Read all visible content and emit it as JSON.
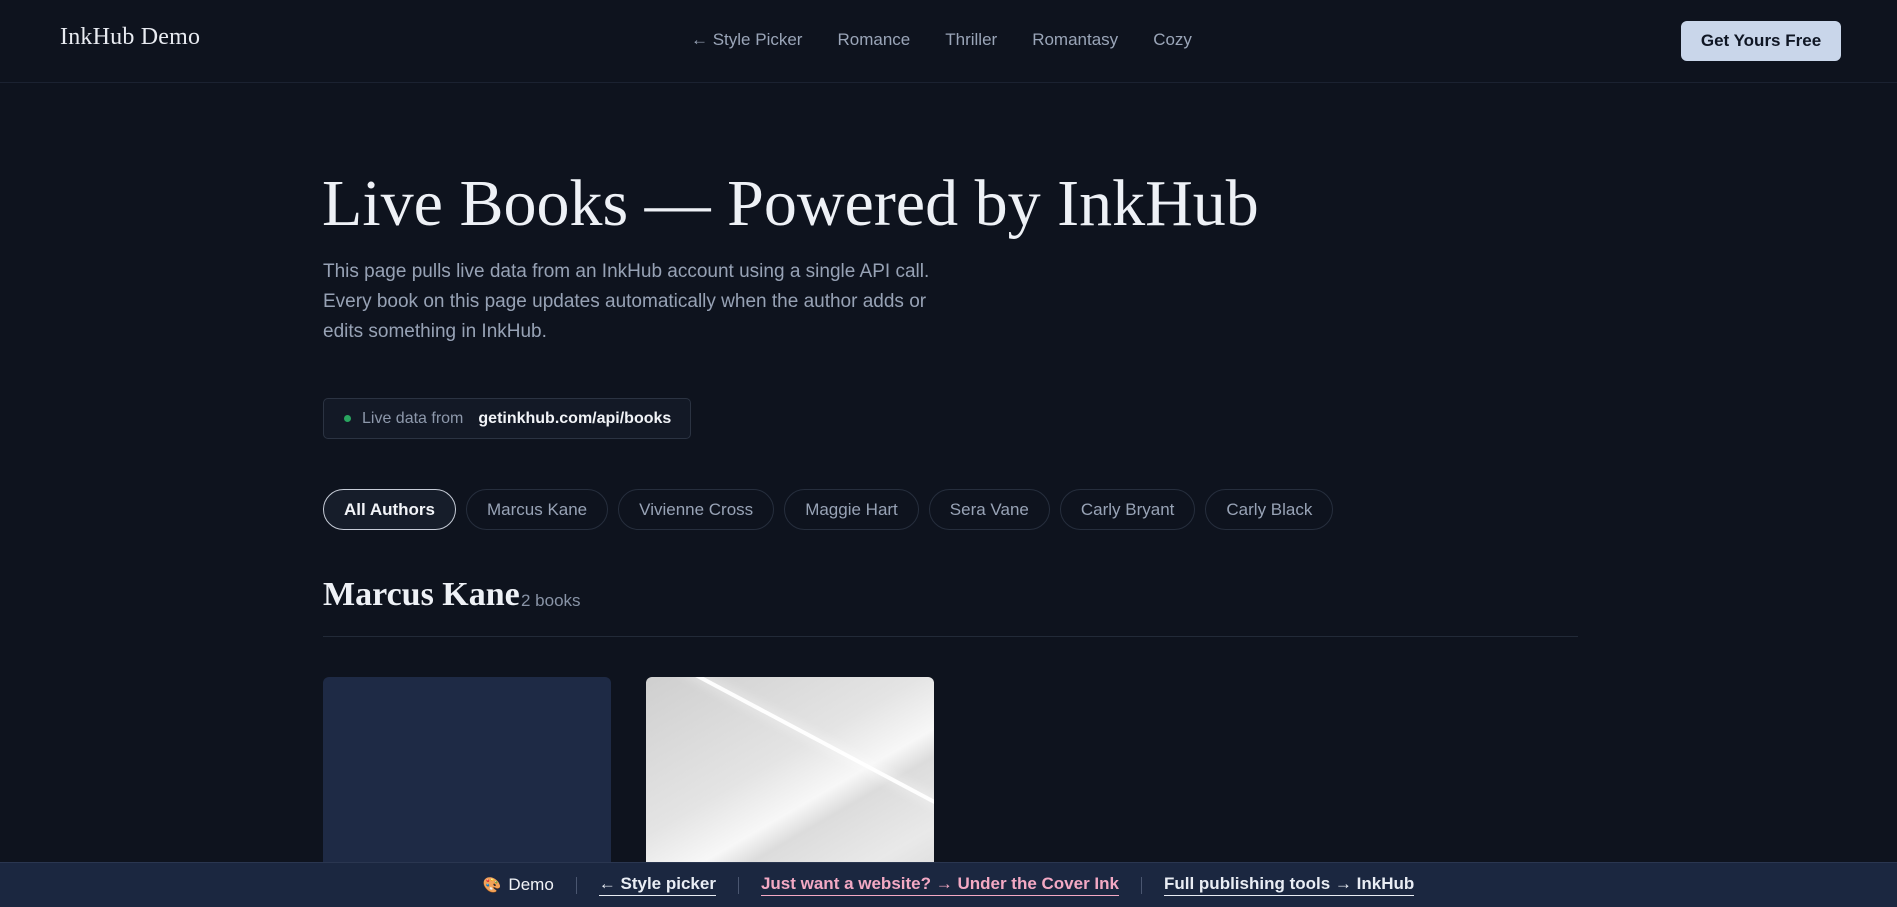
{
  "header": {
    "brand": "InkHub Demo",
    "nav": [
      "← Style Picker",
      "Romance",
      "Thriller",
      "Romantasy",
      "Cozy"
    ],
    "cta": "Get Yours Free"
  },
  "hero": {
    "title": "Live Books — Powered by InkHub",
    "description": "This page pulls live data from an InkHub account using a single API call. Every book on this page updates automatically when the author adds or edits something in InkHub.",
    "live_label": "Live data from",
    "live_url": "getinkhub.com/api/books"
  },
  "filters": {
    "active": "All Authors",
    "chips": [
      "All Authors",
      "Marcus Kane",
      "Vivienne Cross",
      "Maggie Hart",
      "Sera Vane",
      "Carly Bryant",
      "Carly Black"
    ]
  },
  "section": {
    "author": "Marcus Kane",
    "count": "2 books"
  },
  "books": [
    {
      "cover_color": "#1e2a45"
    },
    {
      "cover_color": "#e4e4e4"
    }
  ],
  "demobar": {
    "demo_label": "Demo",
    "style_picker": "← Style picker",
    "website_link": "Just want a website? → Under the Cover Ink",
    "tools_link": "Full publishing tools → InkHub"
  },
  "colors": {
    "background": "#0e131e",
    "cta_bg": "#c9d6ea",
    "live_dot": "#29a55f",
    "demobar_bg": "#1b2740",
    "pink_link": "#f3a9c4"
  }
}
